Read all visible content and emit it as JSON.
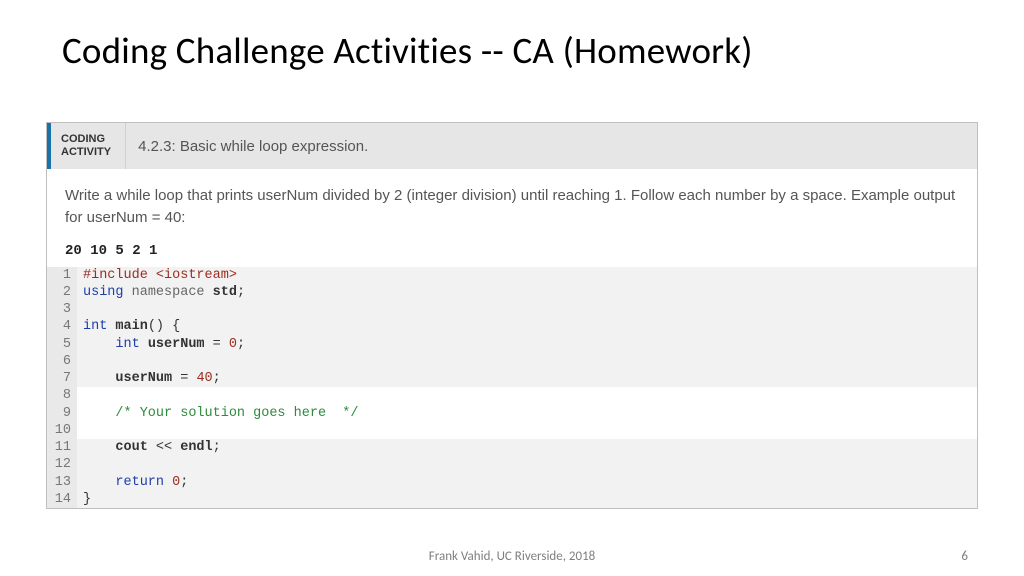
{
  "slide": {
    "title": "Coding Challenge Activities -- CA (Homework)",
    "footer": "Frank Vahid, UC Riverside, 2018",
    "page": "6"
  },
  "activity": {
    "badge_line1": "CODING",
    "badge_line2": "ACTIVITY",
    "title": "4.2.3: Basic while loop expression.",
    "instructions": "Write a while loop that prints userNum divided by 2 (integer division) until reaching 1. Follow each number by a space. Example output for userNum = 40:",
    "example_output": "20 10 5 2 1"
  },
  "code": {
    "lines": [
      {
        "n": "1",
        "tokens": [
          [
            "pp",
            "#include <iostream>"
          ]
        ]
      },
      {
        "n": "2",
        "tokens": [
          [
            "kw",
            "using"
          ],
          [
            "sp",
            " "
          ],
          [
            "ns",
            "namespace"
          ],
          [
            "sp",
            " "
          ],
          [
            "id bold",
            "std"
          ],
          [
            "punc",
            ";"
          ]
        ]
      },
      {
        "n": "3",
        "tokens": []
      },
      {
        "n": "4",
        "tokens": [
          [
            "type",
            "int"
          ],
          [
            "sp",
            " "
          ],
          [
            "id bold",
            "main"
          ],
          [
            "punc",
            "()"
          ],
          [
            "sp",
            " "
          ],
          [
            "punc",
            "{"
          ]
        ]
      },
      {
        "n": "5",
        "tokens": [
          [
            "sp",
            "    "
          ],
          [
            "type",
            "int"
          ],
          [
            "sp",
            " "
          ],
          [
            "id bold",
            "userNum"
          ],
          [
            "sp",
            " "
          ],
          [
            "punc",
            "="
          ],
          [
            "sp",
            " "
          ],
          [
            "num",
            "0"
          ],
          [
            "punc",
            ";"
          ]
        ]
      },
      {
        "n": "6",
        "tokens": []
      },
      {
        "n": "7",
        "tokens": [
          [
            "sp",
            "    "
          ],
          [
            "id bold",
            "userNum"
          ],
          [
            "sp",
            " "
          ],
          [
            "punc",
            "="
          ],
          [
            "sp",
            " "
          ],
          [
            "num",
            "40"
          ],
          [
            "punc",
            ";"
          ]
        ]
      },
      {
        "n": "8",
        "tokens": []
      },
      {
        "n": "9",
        "tokens": [
          [
            "sp",
            "    "
          ],
          [
            "cm",
            "/* Your solution goes here  */"
          ]
        ]
      },
      {
        "n": "10",
        "tokens": []
      },
      {
        "n": "11",
        "tokens": [
          [
            "sp",
            "    "
          ],
          [
            "id bold",
            "cout"
          ],
          [
            "sp",
            " "
          ],
          [
            "punc",
            "<<"
          ],
          [
            "sp",
            " "
          ],
          [
            "id bold",
            "endl"
          ],
          [
            "punc",
            ";"
          ]
        ]
      },
      {
        "n": "12",
        "tokens": []
      },
      {
        "n": "13",
        "tokens": [
          [
            "sp",
            "    "
          ],
          [
            "kw",
            "return"
          ],
          [
            "sp",
            " "
          ],
          [
            "num",
            "0"
          ],
          [
            "punc",
            ";"
          ]
        ]
      },
      {
        "n": "14",
        "tokens": [
          [
            "punc",
            "}"
          ]
        ]
      }
    ],
    "nogutter_lines": [
      "8",
      "10"
    ]
  }
}
